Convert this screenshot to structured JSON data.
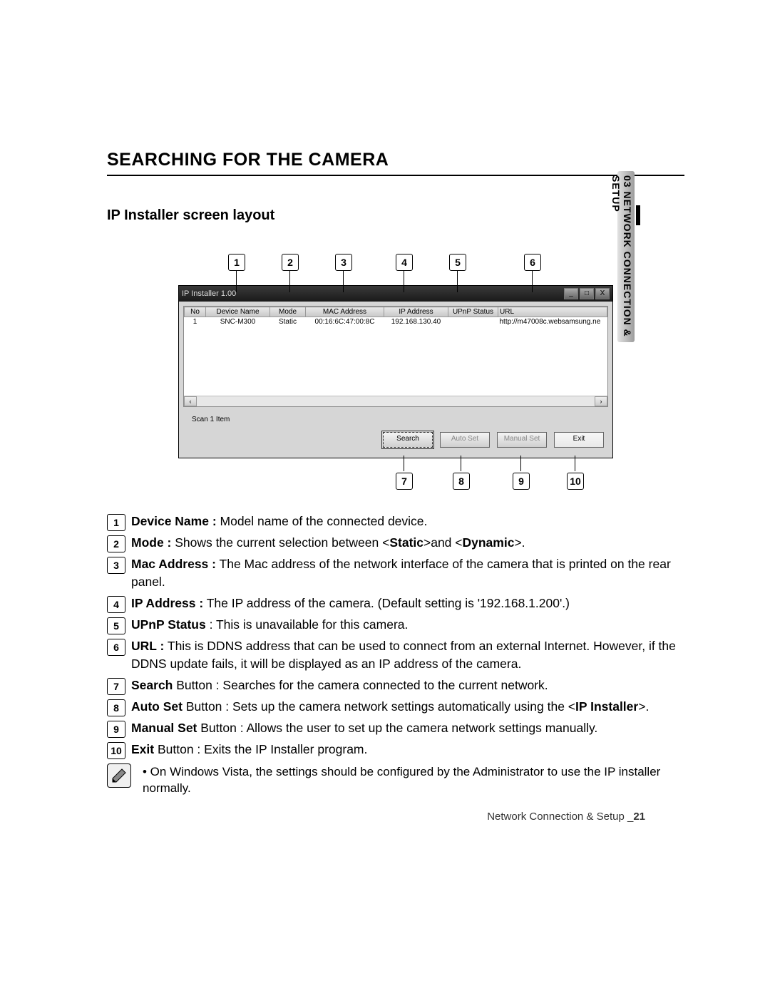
{
  "side_tab": {
    "chapter_num": "03",
    "chapter_title": "NETWORK CONNECTION & SETUP"
  },
  "section": {
    "title": "SEARCHING FOR THE CAMERA",
    "subtitle": "IP Installer screen layout"
  },
  "app": {
    "window_title": "IP Installer 1.00",
    "columns": {
      "no": "No",
      "device": "Device Name",
      "mode": "Mode",
      "mac": "MAC Address",
      "ip": "IP Address",
      "upnp": "UPnP Status",
      "url": "URL"
    },
    "row": {
      "no": "1",
      "device": "SNC-M300",
      "mode": "Static",
      "mac": "00:16:6C:47:00:8C",
      "ip": "192.168.130.40",
      "upnp": "",
      "url": "http://m47008c.websamsung.ne"
    },
    "status": "Scan 1 Item",
    "buttons": {
      "search": "Search",
      "auto": "Auto Set",
      "manual": "Manual Set",
      "exit": "Exit"
    },
    "win_controls": {
      "min": "_",
      "max": "□",
      "close": "X"
    }
  },
  "callouts_top": [
    "1",
    "2",
    "3",
    "4",
    "5",
    "6"
  ],
  "callouts_bottom": [
    "7",
    "8",
    "9",
    "10"
  ],
  "descriptions": [
    {
      "n": "1",
      "term": "Device Name :",
      "text": " Model name of the connected device."
    },
    {
      "n": "2",
      "term": "Mode :",
      "text": " Shows the current selection between <",
      "bold2": "Static",
      "mid": ">and <",
      "bold3": "Dynamic",
      "tail": ">."
    },
    {
      "n": "3",
      "term": "Mac Address :",
      "text": " The Mac address of the network interface of the camera that is printed on the rear panel."
    },
    {
      "n": "4",
      "term": "IP Address :",
      "text": " The IP address of the camera. (Default setting is '192.168.1.200'.)"
    },
    {
      "n": "5",
      "term": "UPnP Status",
      "text": " : This is unavailable for this camera."
    },
    {
      "n": "6",
      "term": "URL :",
      "text": " This is DDNS address that can be used to connect from an external Internet. However, if the DDNS update fails, it will be displayed as an IP address of the camera."
    },
    {
      "n": "7",
      "term": "Search",
      "text": " Button : Searches for the camera connected to the current network."
    },
    {
      "n": "8",
      "term": "Auto Set",
      "text": " Button : Sets up the camera network settings automatically using the <",
      "bold2": "IP Installer",
      "tail": ">."
    },
    {
      "n": "9",
      "term": "Manual Set",
      "text": " Button : Allows the user to set up the camera network settings manually."
    },
    {
      "n": "10",
      "term": "Exit",
      "text": " Button : Exits the IP Installer program."
    }
  ],
  "note": "• On Windows Vista, the settings should be configured by the Administrator to use the IP installer normally.",
  "footer": {
    "label": "Network Connection & Setup _",
    "page": "21"
  }
}
